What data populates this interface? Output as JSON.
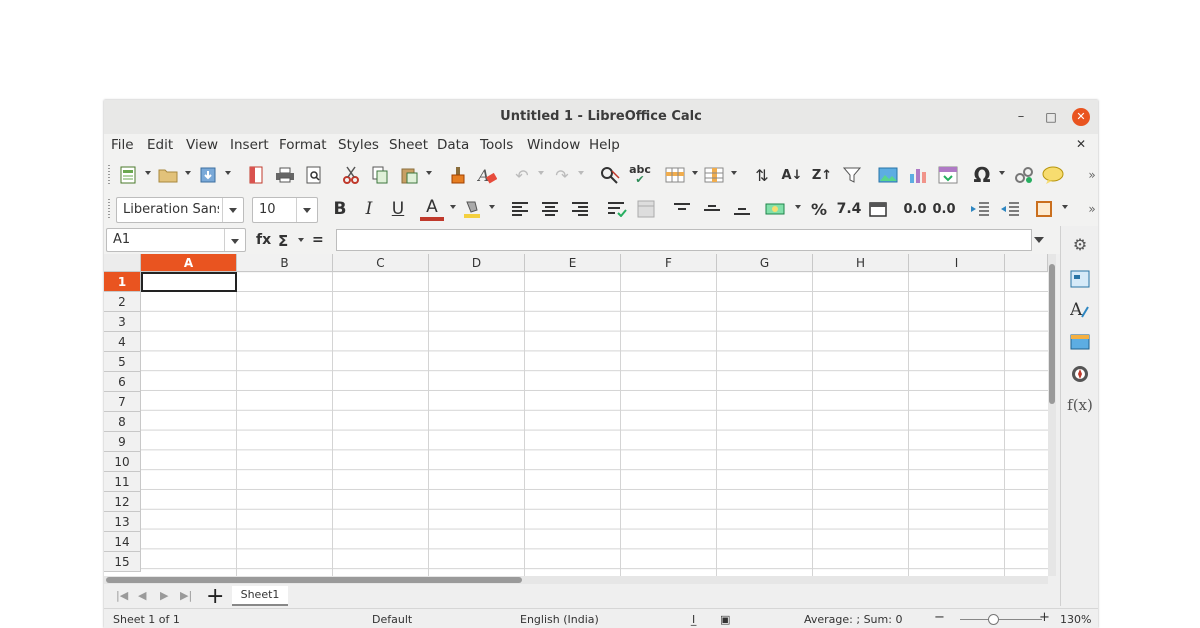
{
  "window": {
    "title": "Untitled 1 - LibreOffice Calc",
    "minimize": "–",
    "maximize": "□",
    "close": "✕"
  },
  "menu": [
    "File",
    "Edit",
    "View",
    "Insert",
    "Format",
    "Styles",
    "Sheet",
    "Data",
    "Tools",
    "Window",
    "Help"
  ],
  "menu_close": "✕",
  "toolbar2": {
    "font_name": "Liberation Sans",
    "font_size": "10",
    "bold": "B",
    "italic": "I",
    "underline": "U",
    "font_color": "A",
    "percent": "%",
    "number": "7.4",
    "add_decimal": "0.0",
    "del_decimal": "0.0"
  },
  "toolbar1": {
    "special_char": "Ω",
    "spelling": "abc"
  },
  "formula": {
    "name_box": "A1",
    "function_wizard": "fx",
    "sum": "Σ",
    "equals": "="
  },
  "columns": [
    "A",
    "B",
    "C",
    "D",
    "E",
    "F",
    "G",
    "H",
    "I"
  ],
  "rows": [
    "1",
    "2",
    "3",
    "4",
    "5",
    "6",
    "7",
    "8",
    "9",
    "10",
    "11",
    "12",
    "13",
    "14",
    "15"
  ],
  "active_cell": {
    "column": "A",
    "row": "1"
  },
  "sheets": [
    "Sheet1"
  ],
  "add_sheet": "+",
  "sidebar": {
    "functions": "f(x)"
  },
  "status": {
    "sheet": "Sheet 1 of 1",
    "page_style": "Default",
    "language": "English (India)",
    "summary": "Average: ; Sum: 0",
    "zoom_minus": "−",
    "zoom_plus": "+",
    "zoom": "130%"
  },
  "colors": {
    "accent": "#e95420",
    "chrome": "#efefef"
  }
}
